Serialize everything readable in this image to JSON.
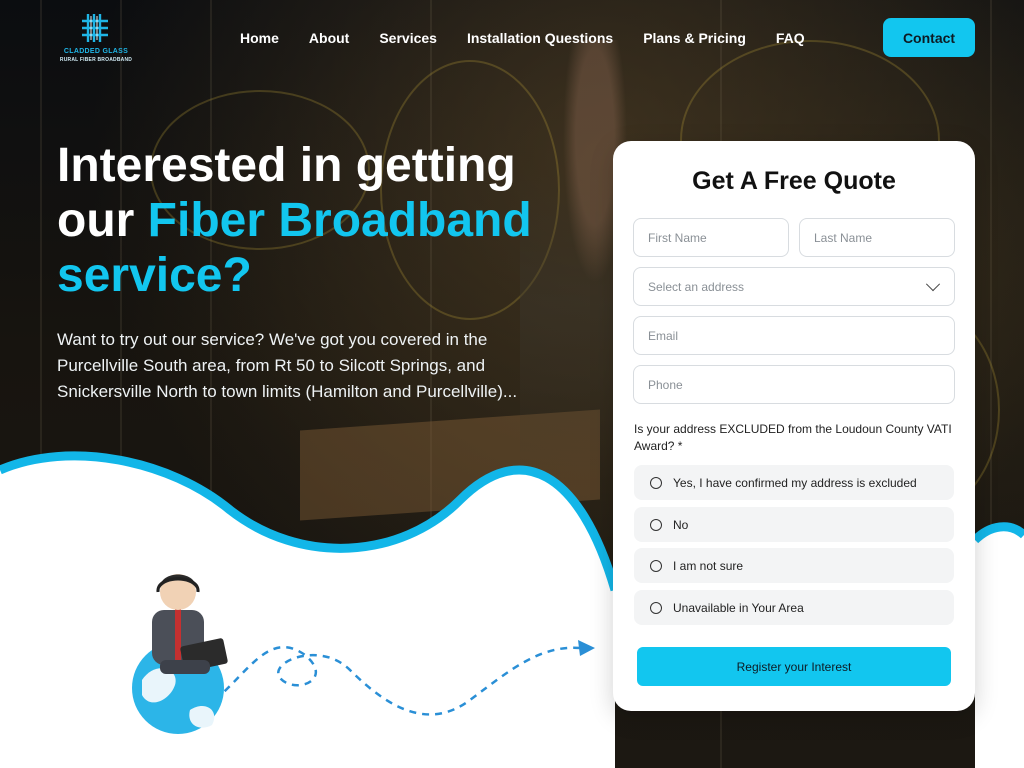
{
  "brand": {
    "name_line1": "CLADDED GLASS",
    "name_line2": "RURAL FIBER BROADBAND"
  },
  "nav": {
    "items": [
      {
        "label": "Home"
      },
      {
        "label": "About"
      },
      {
        "label": "Services"
      },
      {
        "label": "Installation Questions"
      },
      {
        "label": "Plans & Pricing"
      },
      {
        "label": "FAQ"
      }
    ],
    "contact_label": "Contact"
  },
  "hero": {
    "title_part1": "Interested in getting our ",
    "title_accent": "Fiber Broadband service?",
    "description": "Want to try out our service? We've got you covered in the Purcellville South area, from Rt 50 to Silcott Springs, and Snickersville North to town limits (Hamilton and Purcellville)..."
  },
  "quote_form": {
    "title": "Get A Free Quote",
    "first_name_placeholder": "First Name",
    "last_name_placeholder": "Last Name",
    "address_placeholder": "Select an address",
    "email_placeholder": "Email",
    "phone_placeholder": "Phone",
    "question": "Is your address EXCLUDED from the Loudoun County VATI Award? *",
    "options": [
      {
        "label": "Yes, I have confirmed my address is excluded"
      },
      {
        "label": "No"
      },
      {
        "label": "I am not sure"
      },
      {
        "label": "Unavailable in Your Area"
      }
    ],
    "submit_label": "Register your Interest"
  },
  "colors": {
    "accent": "#12c6ef",
    "dark_bg": "#0b0d10",
    "wave_blue": "#12b6e8"
  },
  "icons": {
    "logo": "fiber-grid-logo-icon",
    "dropdown": "chevron-down-icon",
    "radio": "radio-circle-icon",
    "illustration": "support-agent-on-globe-icon"
  }
}
